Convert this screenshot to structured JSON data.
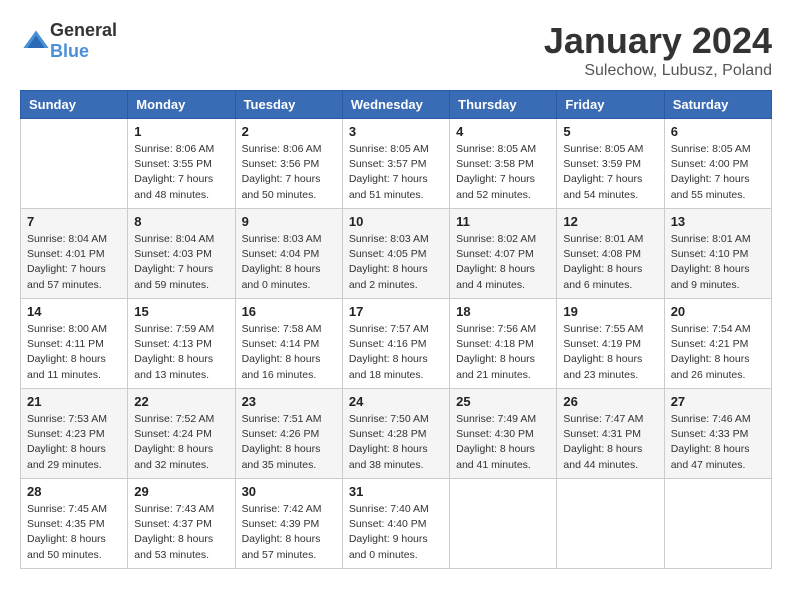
{
  "header": {
    "logo_general": "General",
    "logo_blue": "Blue",
    "month": "January 2024",
    "location": "Sulechow, Lubusz, Poland"
  },
  "days_of_week": [
    "Sunday",
    "Monday",
    "Tuesday",
    "Wednesday",
    "Thursday",
    "Friday",
    "Saturday"
  ],
  "weeks": [
    [
      {
        "day": "",
        "info": ""
      },
      {
        "day": "1",
        "info": "Sunrise: 8:06 AM\nSunset: 3:55 PM\nDaylight: 7 hours\nand 48 minutes."
      },
      {
        "day": "2",
        "info": "Sunrise: 8:06 AM\nSunset: 3:56 PM\nDaylight: 7 hours\nand 50 minutes."
      },
      {
        "day": "3",
        "info": "Sunrise: 8:05 AM\nSunset: 3:57 PM\nDaylight: 7 hours\nand 51 minutes."
      },
      {
        "day": "4",
        "info": "Sunrise: 8:05 AM\nSunset: 3:58 PM\nDaylight: 7 hours\nand 52 minutes."
      },
      {
        "day": "5",
        "info": "Sunrise: 8:05 AM\nSunset: 3:59 PM\nDaylight: 7 hours\nand 54 minutes."
      },
      {
        "day": "6",
        "info": "Sunrise: 8:05 AM\nSunset: 4:00 PM\nDaylight: 7 hours\nand 55 minutes."
      }
    ],
    [
      {
        "day": "7",
        "info": "Sunrise: 8:04 AM\nSunset: 4:01 PM\nDaylight: 7 hours\nand 57 minutes."
      },
      {
        "day": "8",
        "info": "Sunrise: 8:04 AM\nSunset: 4:03 PM\nDaylight: 7 hours\nand 59 minutes."
      },
      {
        "day": "9",
        "info": "Sunrise: 8:03 AM\nSunset: 4:04 PM\nDaylight: 8 hours\nand 0 minutes."
      },
      {
        "day": "10",
        "info": "Sunrise: 8:03 AM\nSunset: 4:05 PM\nDaylight: 8 hours\nand 2 minutes."
      },
      {
        "day": "11",
        "info": "Sunrise: 8:02 AM\nSunset: 4:07 PM\nDaylight: 8 hours\nand 4 minutes."
      },
      {
        "day": "12",
        "info": "Sunrise: 8:01 AM\nSunset: 4:08 PM\nDaylight: 8 hours\nand 6 minutes."
      },
      {
        "day": "13",
        "info": "Sunrise: 8:01 AM\nSunset: 4:10 PM\nDaylight: 8 hours\nand 9 minutes."
      }
    ],
    [
      {
        "day": "14",
        "info": "Sunrise: 8:00 AM\nSunset: 4:11 PM\nDaylight: 8 hours\nand 11 minutes."
      },
      {
        "day": "15",
        "info": "Sunrise: 7:59 AM\nSunset: 4:13 PM\nDaylight: 8 hours\nand 13 minutes."
      },
      {
        "day": "16",
        "info": "Sunrise: 7:58 AM\nSunset: 4:14 PM\nDaylight: 8 hours\nand 16 minutes."
      },
      {
        "day": "17",
        "info": "Sunrise: 7:57 AM\nSunset: 4:16 PM\nDaylight: 8 hours\nand 18 minutes."
      },
      {
        "day": "18",
        "info": "Sunrise: 7:56 AM\nSunset: 4:18 PM\nDaylight: 8 hours\nand 21 minutes."
      },
      {
        "day": "19",
        "info": "Sunrise: 7:55 AM\nSunset: 4:19 PM\nDaylight: 8 hours\nand 23 minutes."
      },
      {
        "day": "20",
        "info": "Sunrise: 7:54 AM\nSunset: 4:21 PM\nDaylight: 8 hours\nand 26 minutes."
      }
    ],
    [
      {
        "day": "21",
        "info": "Sunrise: 7:53 AM\nSunset: 4:23 PM\nDaylight: 8 hours\nand 29 minutes."
      },
      {
        "day": "22",
        "info": "Sunrise: 7:52 AM\nSunset: 4:24 PM\nDaylight: 8 hours\nand 32 minutes."
      },
      {
        "day": "23",
        "info": "Sunrise: 7:51 AM\nSunset: 4:26 PM\nDaylight: 8 hours\nand 35 minutes."
      },
      {
        "day": "24",
        "info": "Sunrise: 7:50 AM\nSunset: 4:28 PM\nDaylight: 8 hours\nand 38 minutes."
      },
      {
        "day": "25",
        "info": "Sunrise: 7:49 AM\nSunset: 4:30 PM\nDaylight: 8 hours\nand 41 minutes."
      },
      {
        "day": "26",
        "info": "Sunrise: 7:47 AM\nSunset: 4:31 PM\nDaylight: 8 hours\nand 44 minutes."
      },
      {
        "day": "27",
        "info": "Sunrise: 7:46 AM\nSunset: 4:33 PM\nDaylight: 8 hours\nand 47 minutes."
      }
    ],
    [
      {
        "day": "28",
        "info": "Sunrise: 7:45 AM\nSunset: 4:35 PM\nDaylight: 8 hours\nand 50 minutes."
      },
      {
        "day": "29",
        "info": "Sunrise: 7:43 AM\nSunset: 4:37 PM\nDaylight: 8 hours\nand 53 minutes."
      },
      {
        "day": "30",
        "info": "Sunrise: 7:42 AM\nSunset: 4:39 PM\nDaylight: 8 hours\nand 57 minutes."
      },
      {
        "day": "31",
        "info": "Sunrise: 7:40 AM\nSunset: 4:40 PM\nDaylight: 9 hours\nand 0 minutes."
      },
      {
        "day": "",
        "info": ""
      },
      {
        "day": "",
        "info": ""
      },
      {
        "day": "",
        "info": ""
      }
    ]
  ]
}
